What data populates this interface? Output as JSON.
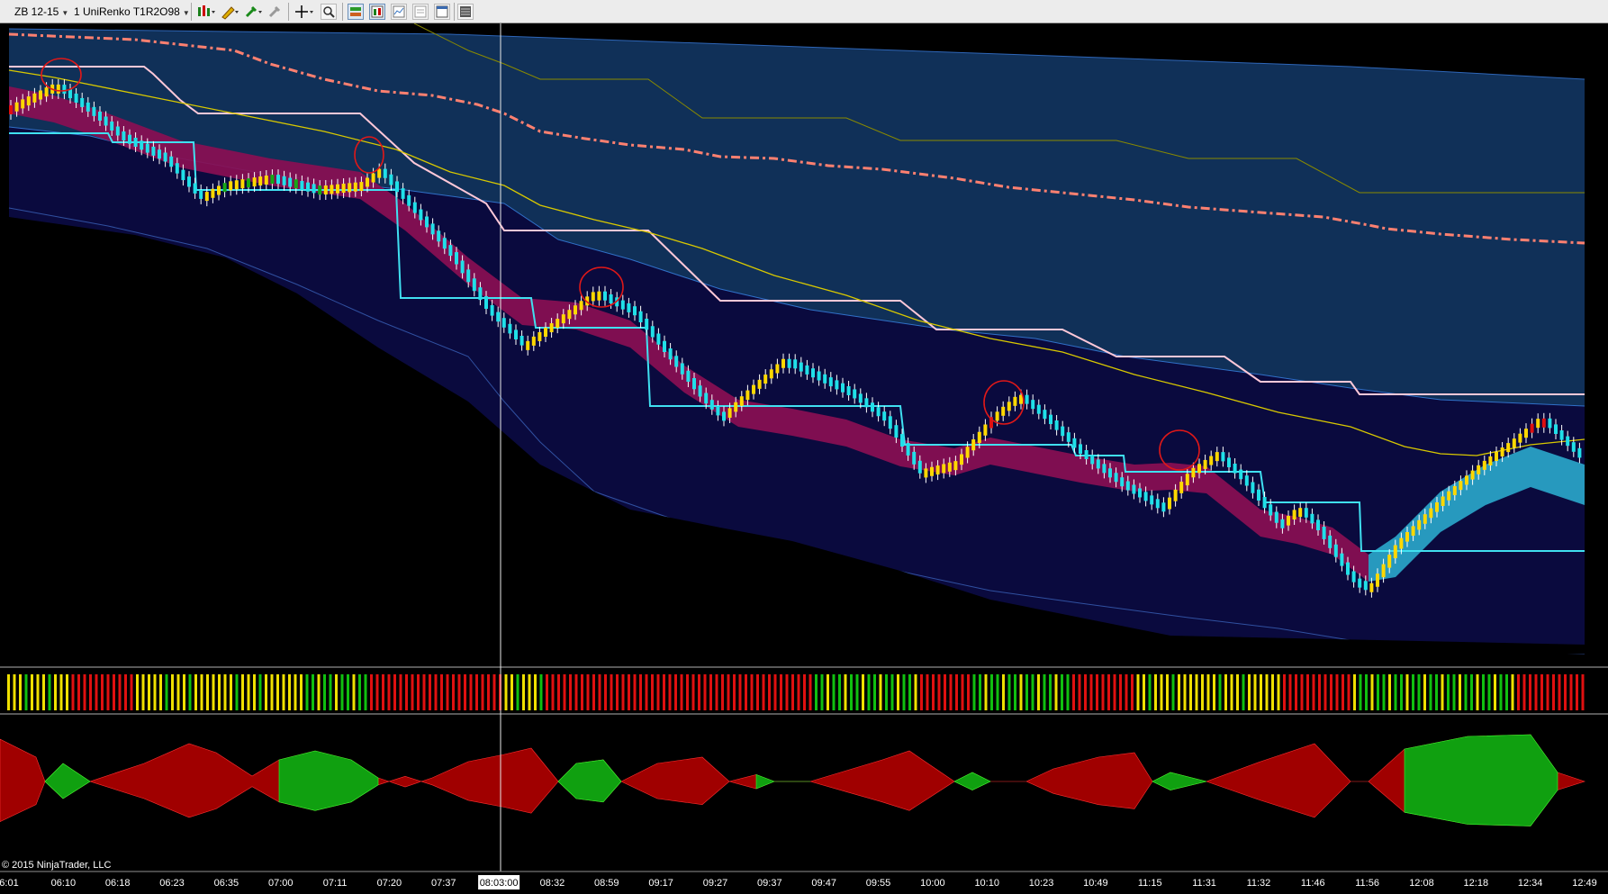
{
  "toolbar": {
    "instrument": "ZB 12-15",
    "chart_type": "1 UniRenko T1R2O98",
    "icons": [
      "bars-type-icon",
      "pencil-draw-icon",
      "marker-icon",
      "pointer-icon",
      "crosshair-icon",
      "zoom-icon",
      "strategy-icon",
      "indicator-icon",
      "data-series-icon",
      "chart-trader-icon",
      "properties-icon",
      "window-icon"
    ]
  },
  "chart": {
    "background": "#000000",
    "crosshair_time": "08:03:00",
    "copyright": "© 2015 NinjaTrader, LLC",
    "time_ticks": [
      "6:01",
      "06:10",
      "06:18",
      "06:23",
      "06:35",
      "07:00",
      "07:11",
      "07:20",
      "07:37",
      "08:03:00",
      "08:32",
      "08:59",
      "09:17",
      "09:27",
      "09:37",
      "09:47",
      "09:55",
      "10:00",
      "10:10",
      "10:23",
      "10:49",
      "11:15",
      "11:31",
      "11:32",
      "11:46",
      "11:56",
      "12:08",
      "12:18",
      "12:34",
      "12:49"
    ],
    "colors": {
      "bull_candle": "#ffd800",
      "bear_candle": "#ffffff",
      "wick": "#ffffff",
      "cyan_candle": "#20e0e8",
      "red_candle": "#e01010",
      "green_candle": "#16a816",
      "ribbon_down": "#8a0f52",
      "ribbon_up": "#2aa8cc",
      "upper_band": "#103058",
      "lower_band": "#0a0a3e",
      "stop_line": "#ffc8d8",
      "support_line": "#40e0f0",
      "dash_line": "#ff8070",
      "ma_yellow": "#d8c800",
      "ma_olive": "#8a8a00",
      "osc_red": "#a00000",
      "osc_green": "#10a010",
      "bar_yellow": "#f0e000",
      "bar_red": "#e01010",
      "bar_green": "#10c010"
    },
    "annotation_circles": 6
  }
}
